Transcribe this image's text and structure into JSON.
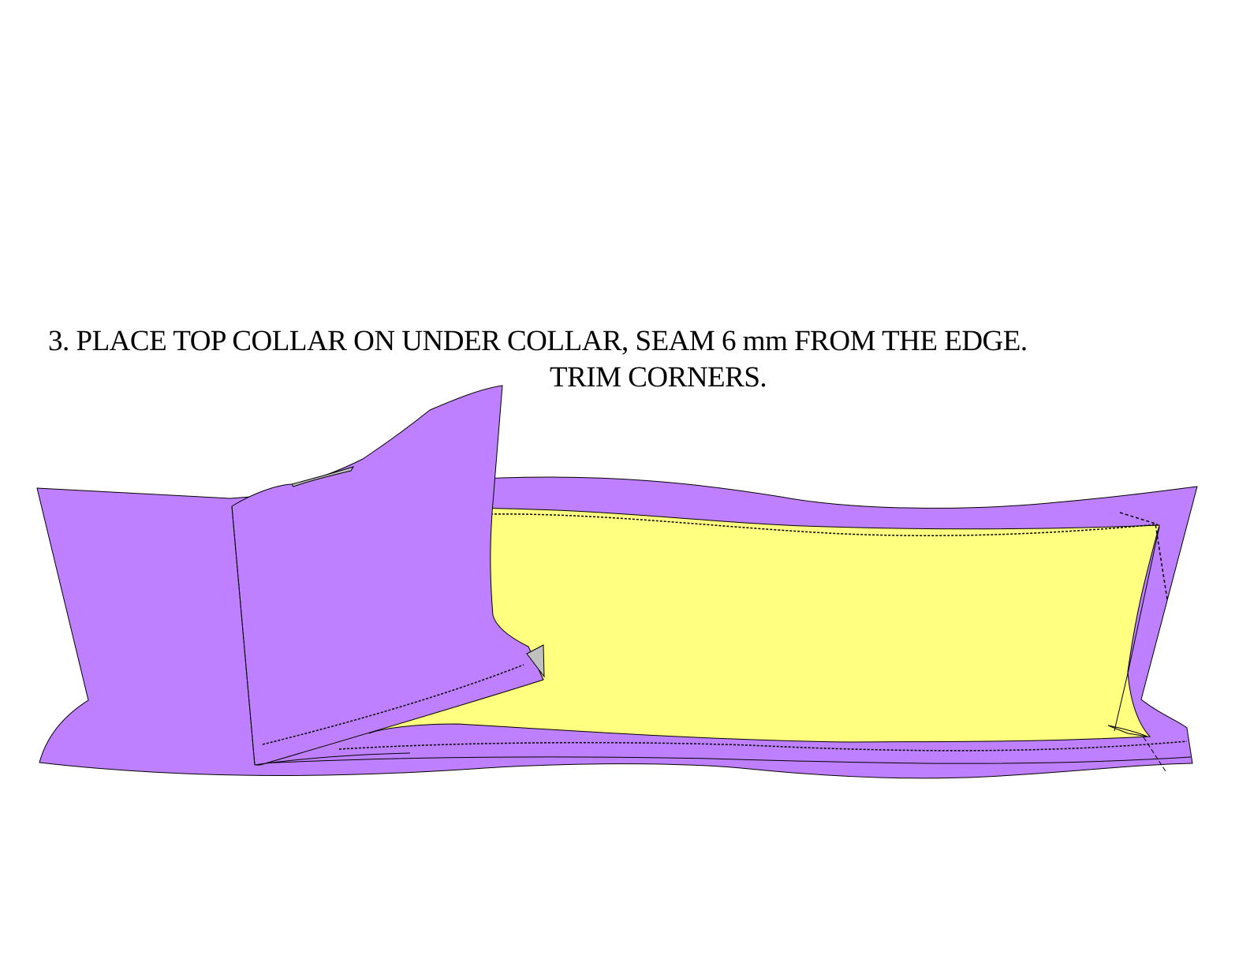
{
  "instruction": {
    "line1": "3. PLACE TOP COLLAR ON UNDER COLLAR, SEAM 6 mm FROM THE EDGE.",
    "line2": "TRIM CORNERS."
  },
  "colors": {
    "under_collar": "#bf80ff",
    "top_collar_lining": "#ffff80",
    "folded_edge": "#c0c0c0",
    "outline": "#000000",
    "background": "#ffffff"
  }
}
